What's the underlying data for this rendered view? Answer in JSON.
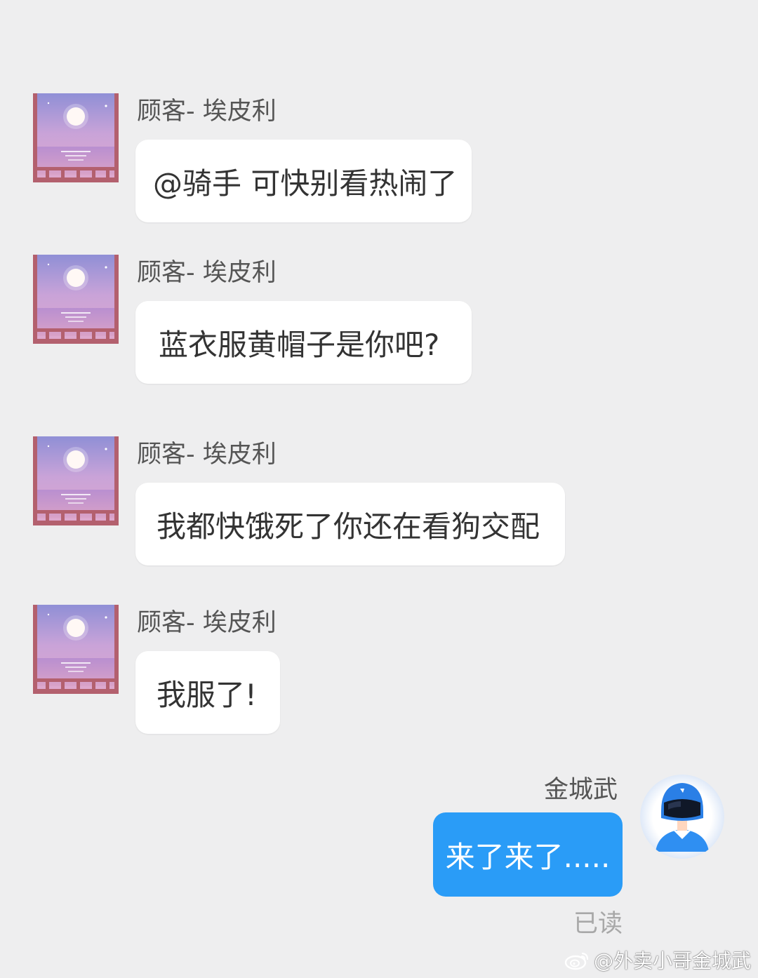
{
  "colors": {
    "background": "#eeeeef",
    "incoming_bubble": "#ffffff",
    "outgoing_bubble": "#2a9cf7",
    "name_text": "#555555",
    "read_status": "#a8a8a8"
  },
  "messages": [
    {
      "sender": "顾客- 埃皮利",
      "text": "@骑手 可快别看热闹了",
      "avatar_icon": "moon-sea-avatar-icon"
    },
    {
      "sender": "顾客- 埃皮利",
      "text": "蓝衣服黄帽子是你吧?",
      "avatar_icon": "moon-sea-avatar-icon"
    },
    {
      "sender": "顾客- 埃皮利",
      "text": "我都快饿死了你还在看狗交配",
      "avatar_icon": "moon-sea-avatar-icon"
    },
    {
      "sender": "顾客- 埃皮利",
      "text": "我服了!",
      "avatar_icon": "moon-sea-avatar-icon"
    }
  ],
  "reply": {
    "sender": "金城武",
    "text": "来了来了.....",
    "status": "已读",
    "avatar_icon": "delivery-rider-helmet-icon"
  },
  "watermark": {
    "icon": "weibo-icon",
    "text": "@外卖小哥金城武"
  }
}
